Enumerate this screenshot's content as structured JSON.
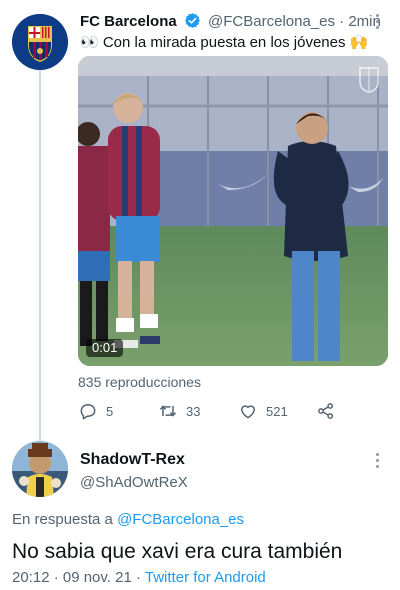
{
  "original_tweet": {
    "display_name": "FC Barcelona",
    "handle": "@FCBarcelona_es",
    "separator": "·",
    "time": "2min",
    "text": "👀 Con la mirada puesta en los jóvenes 🙌",
    "avatar_icon": "fc-barcelona-crest",
    "media": {
      "type": "video",
      "duration": "0:01",
      "watermark_icon": "fcb-crest-watermark"
    },
    "views": "835 reproducciones",
    "actions": {
      "reply_count": "5",
      "retweet_count": "33",
      "like_count": "521"
    }
  },
  "reply_tweet": {
    "display_name": "ShadowT-Rex",
    "handle": "@ShAdOwtReX",
    "avatar_icon": "shadowtrex-avatar",
    "reply_prefix": "En respuesta a",
    "reply_target": "@FCBarcelona_es",
    "text": "No sabia que xavi era cura también",
    "timestamp": "20:12 · 09 nov. 21",
    "footer_separator": "·",
    "client": "Twitter for Android"
  },
  "colors": {
    "accent": "#1d9bf0",
    "secondary_text": "#536471",
    "thread_line": "#cfd9de"
  }
}
